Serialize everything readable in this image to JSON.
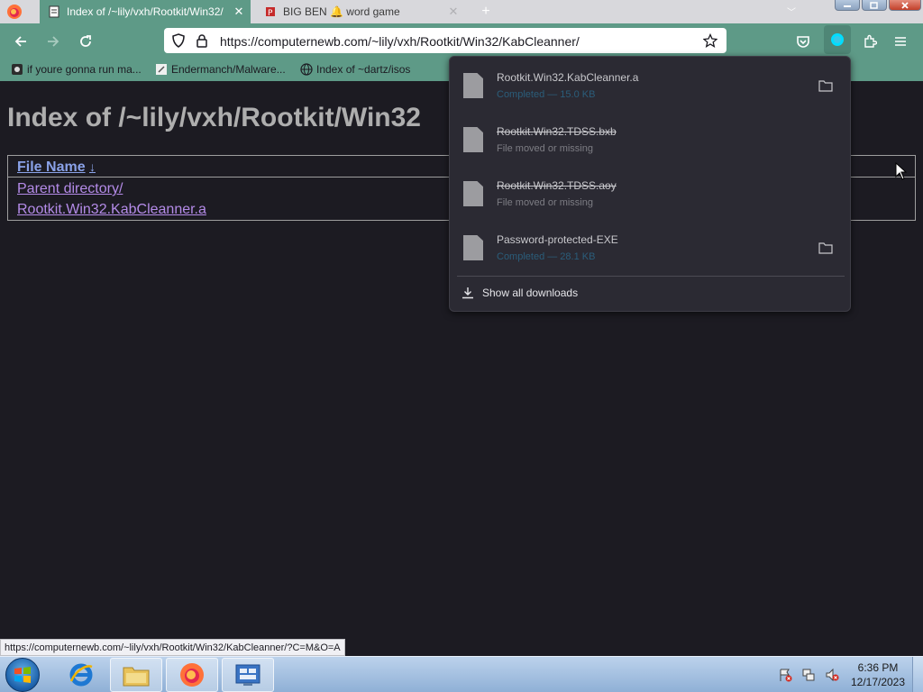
{
  "browser": {
    "tabs": [
      {
        "title": "Index of /~lily/vxh/Rootkit/Win32/",
        "icon": "page-icon",
        "active": true
      },
      {
        "title": "BIG BEN 🔔 word game",
        "icon": "bigben-icon",
        "active": false
      }
    ],
    "url": "https://computernewb.com/~lily/vxh/Rootkit/Win32/KabCleanner/",
    "bookmarks": [
      {
        "label": "if youre gonna run ma...",
        "icon": "bookmark-favicon"
      },
      {
        "label": "Endermanch/Malware...",
        "icon": "github-icon"
      },
      {
        "label": "Index of ~dartz/isos",
        "icon": "globe-icon"
      }
    ],
    "status_url": "https://computernewb.com/~lily/vxh/Rootkit/Win32/KabCleanner/?C=M&O=A"
  },
  "page": {
    "heading": "Index of /~lily/vxh/Rootkit/Win32",
    "column_header": "File Name",
    "sort_indicator": "↓",
    "entries": [
      {
        "label": "Parent directory/"
      },
      {
        "label": "Rootkit.Win32.KabCleanner.a"
      }
    ]
  },
  "downloads": {
    "items": [
      {
        "name": "Rootkit.Win32.KabCleanner.a",
        "status": "Completed — 15.0 KB",
        "state": "completed"
      },
      {
        "name": "Rootkit.Win32.TDSS.bxb",
        "status": "File moved or missing",
        "state": "missing"
      },
      {
        "name": "Rootkit.Win32.TDSS.aoy",
        "status": "File moved or missing",
        "state": "missing"
      },
      {
        "name": "Password-protected-EXE",
        "status": "Completed — 28.1 KB",
        "state": "completed"
      }
    ],
    "show_all_label": "Show all downloads"
  },
  "taskbar": {
    "apps": [
      "internet-explorer-icon",
      "file-explorer-icon",
      "firefox-icon",
      "control-panel-icon"
    ],
    "clock_time": "6:36 PM",
    "clock_date": "12/17/2023"
  },
  "colors": {
    "accent": "#5e9a87",
    "page_background": "#1c1b22",
    "link_visited": "#b48be8",
    "link": "#8aa2e8",
    "panel_background": "#2b2a33"
  }
}
